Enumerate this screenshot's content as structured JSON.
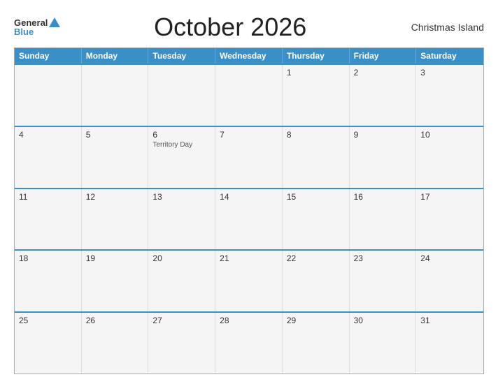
{
  "header": {
    "title": "October 2026",
    "region": "Christmas Island",
    "logo": {
      "general": "General",
      "blue": "Blue"
    }
  },
  "dayNames": [
    "Sunday",
    "Monday",
    "Tuesday",
    "Wednesday",
    "Thursday",
    "Friday",
    "Saturday"
  ],
  "weeks": [
    [
      {
        "num": "",
        "empty": true
      },
      {
        "num": "",
        "empty": true
      },
      {
        "num": "",
        "empty": true
      },
      {
        "num": "",
        "empty": true
      },
      {
        "num": "1"
      },
      {
        "num": "2"
      },
      {
        "num": "3"
      }
    ],
    [
      {
        "num": "4"
      },
      {
        "num": "5"
      },
      {
        "num": "6",
        "holiday": "Territory Day"
      },
      {
        "num": "7"
      },
      {
        "num": "8"
      },
      {
        "num": "9"
      },
      {
        "num": "10"
      }
    ],
    [
      {
        "num": "11"
      },
      {
        "num": "12"
      },
      {
        "num": "13"
      },
      {
        "num": "14"
      },
      {
        "num": "15"
      },
      {
        "num": "16"
      },
      {
        "num": "17"
      }
    ],
    [
      {
        "num": "18"
      },
      {
        "num": "19"
      },
      {
        "num": "20"
      },
      {
        "num": "21"
      },
      {
        "num": "22"
      },
      {
        "num": "23"
      },
      {
        "num": "24"
      }
    ],
    [
      {
        "num": "25"
      },
      {
        "num": "26"
      },
      {
        "num": "27"
      },
      {
        "num": "28"
      },
      {
        "num": "29"
      },
      {
        "num": "30"
      },
      {
        "num": "31"
      }
    ]
  ]
}
